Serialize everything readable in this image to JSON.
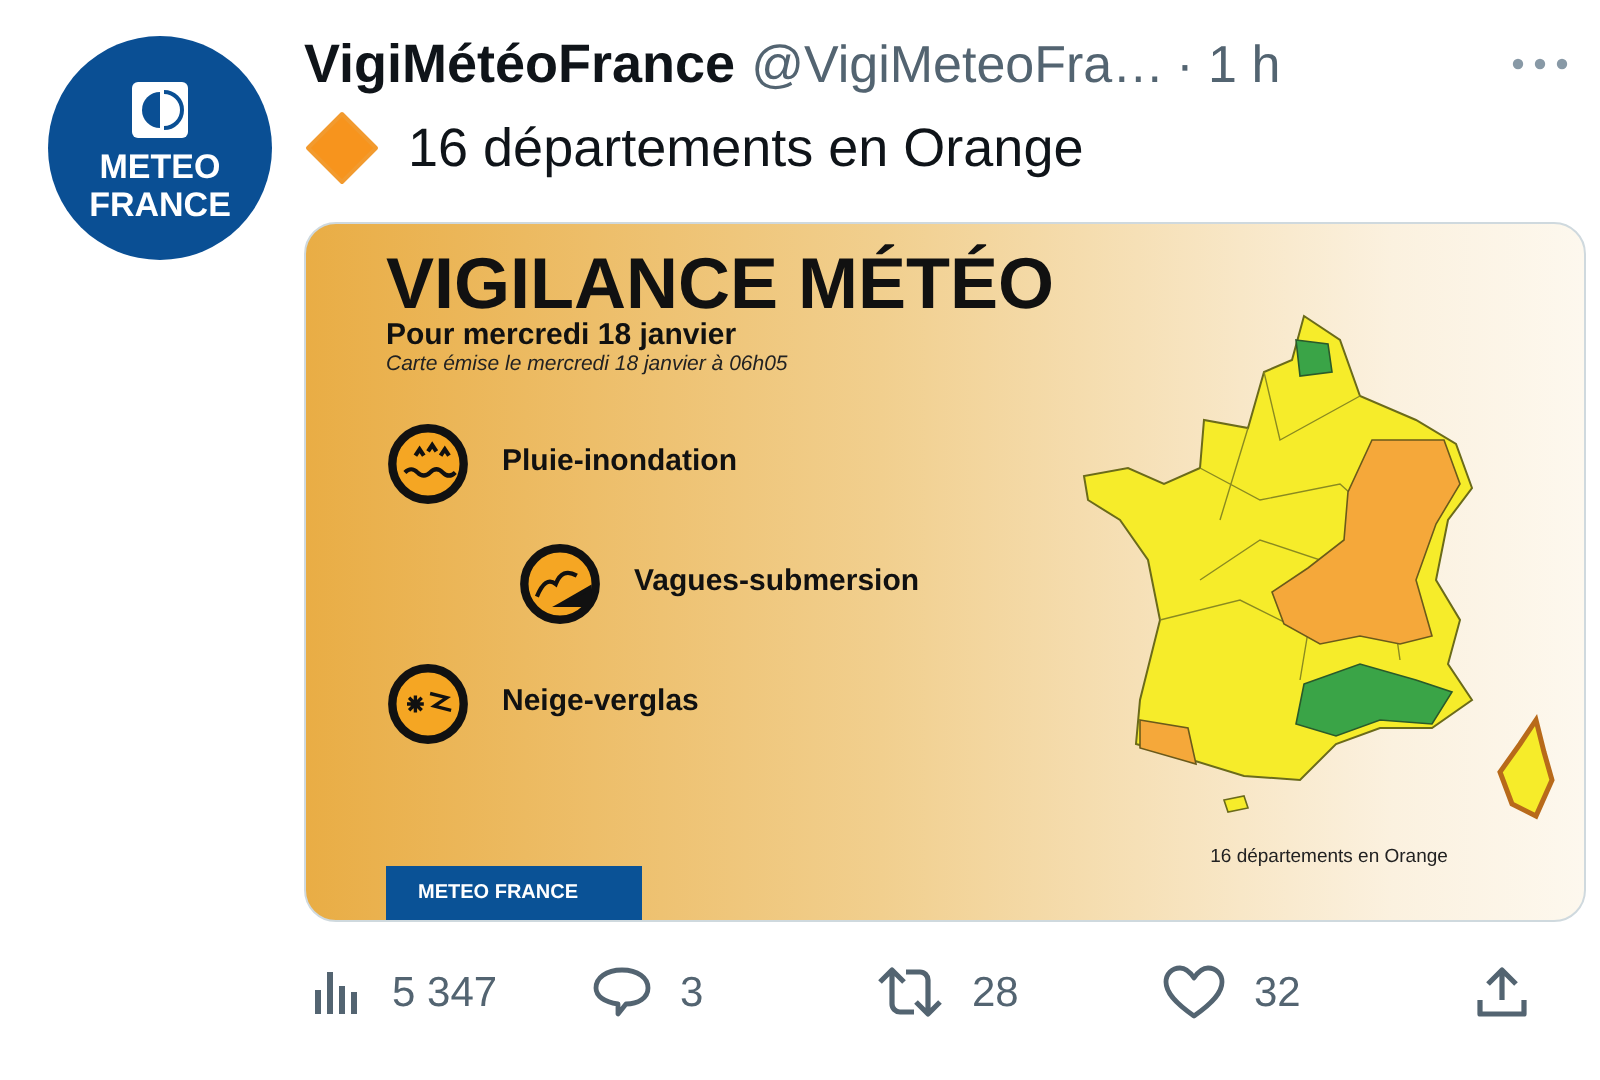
{
  "avatar": {
    "lines": [
      "METEO",
      "FRANCE"
    ]
  },
  "tweet": {
    "name": "VigiMétéoFrance",
    "handle": "@VigiMeteoFra…",
    "time": "· 1 h",
    "text": "16 départements en Orange"
  },
  "card": {
    "title": "VIGILANCE MÉTÉO",
    "subtitle": "Pour mercredi 18 janvier",
    "issued": "Carte émise le mercredi 18 janvier à 06h05",
    "hazards": [
      {
        "kind": "rain-flood",
        "label": "Pluie-inondation",
        "indented": false
      },
      {
        "kind": "waves",
        "label": "Vagues-submersion",
        "indented": true
      },
      {
        "kind": "snow-ice",
        "label": "Neige-verglas",
        "indented": false
      }
    ],
    "map_caption": "16 départements en Orange",
    "footer": "METEO FRANCE"
  },
  "actions": [
    {
      "kind": "views",
      "count": "5 347"
    },
    {
      "kind": "reply",
      "count": "3"
    },
    {
      "kind": "retweet",
      "count": "28"
    },
    {
      "kind": "like",
      "count": "32"
    },
    {
      "kind": "share"
    }
  ]
}
